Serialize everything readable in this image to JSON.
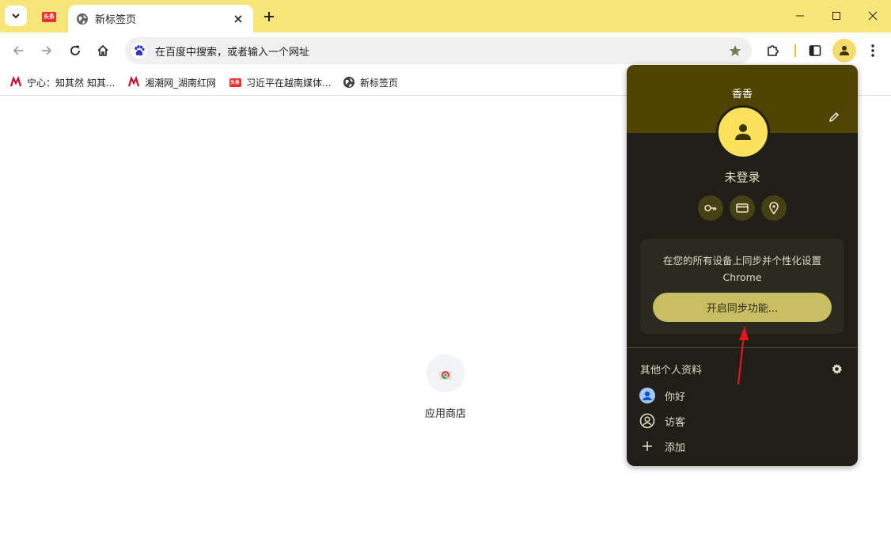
{
  "tabs": {
    "active_title": "新标签页",
    "pinned_badge": "头条"
  },
  "omnibox": {
    "placeholder": "在百度中搜索，或者输入一个网址"
  },
  "bookmarks": [
    {
      "label": "宁心：知其然 知其..."
    },
    {
      "label": "湘潮网_湖南红网"
    },
    {
      "label": "习近平在越南媒体..."
    },
    {
      "label": "新标签页"
    }
  ],
  "shortcut": {
    "label": "应用商店"
  },
  "profile_menu": {
    "name": "香香",
    "status": "未登录",
    "sync_text_line1": "在您的所有设备上同步并个性化设置",
    "sync_text_line2": "Chrome",
    "sync_button": "开启同步功能...",
    "other_profiles_title": "其他个人资料",
    "profiles": [
      {
        "label": "你好"
      },
      {
        "label": "访客"
      },
      {
        "label": "添加"
      }
    ]
  },
  "colors": {
    "tabstrip": "#f8e57a",
    "menu_bg": "#1f1f18",
    "menu_header": "#4e4300",
    "avatar": "#fbe25a",
    "sync_button": "#c9be63",
    "arrow": "#e8141b"
  }
}
